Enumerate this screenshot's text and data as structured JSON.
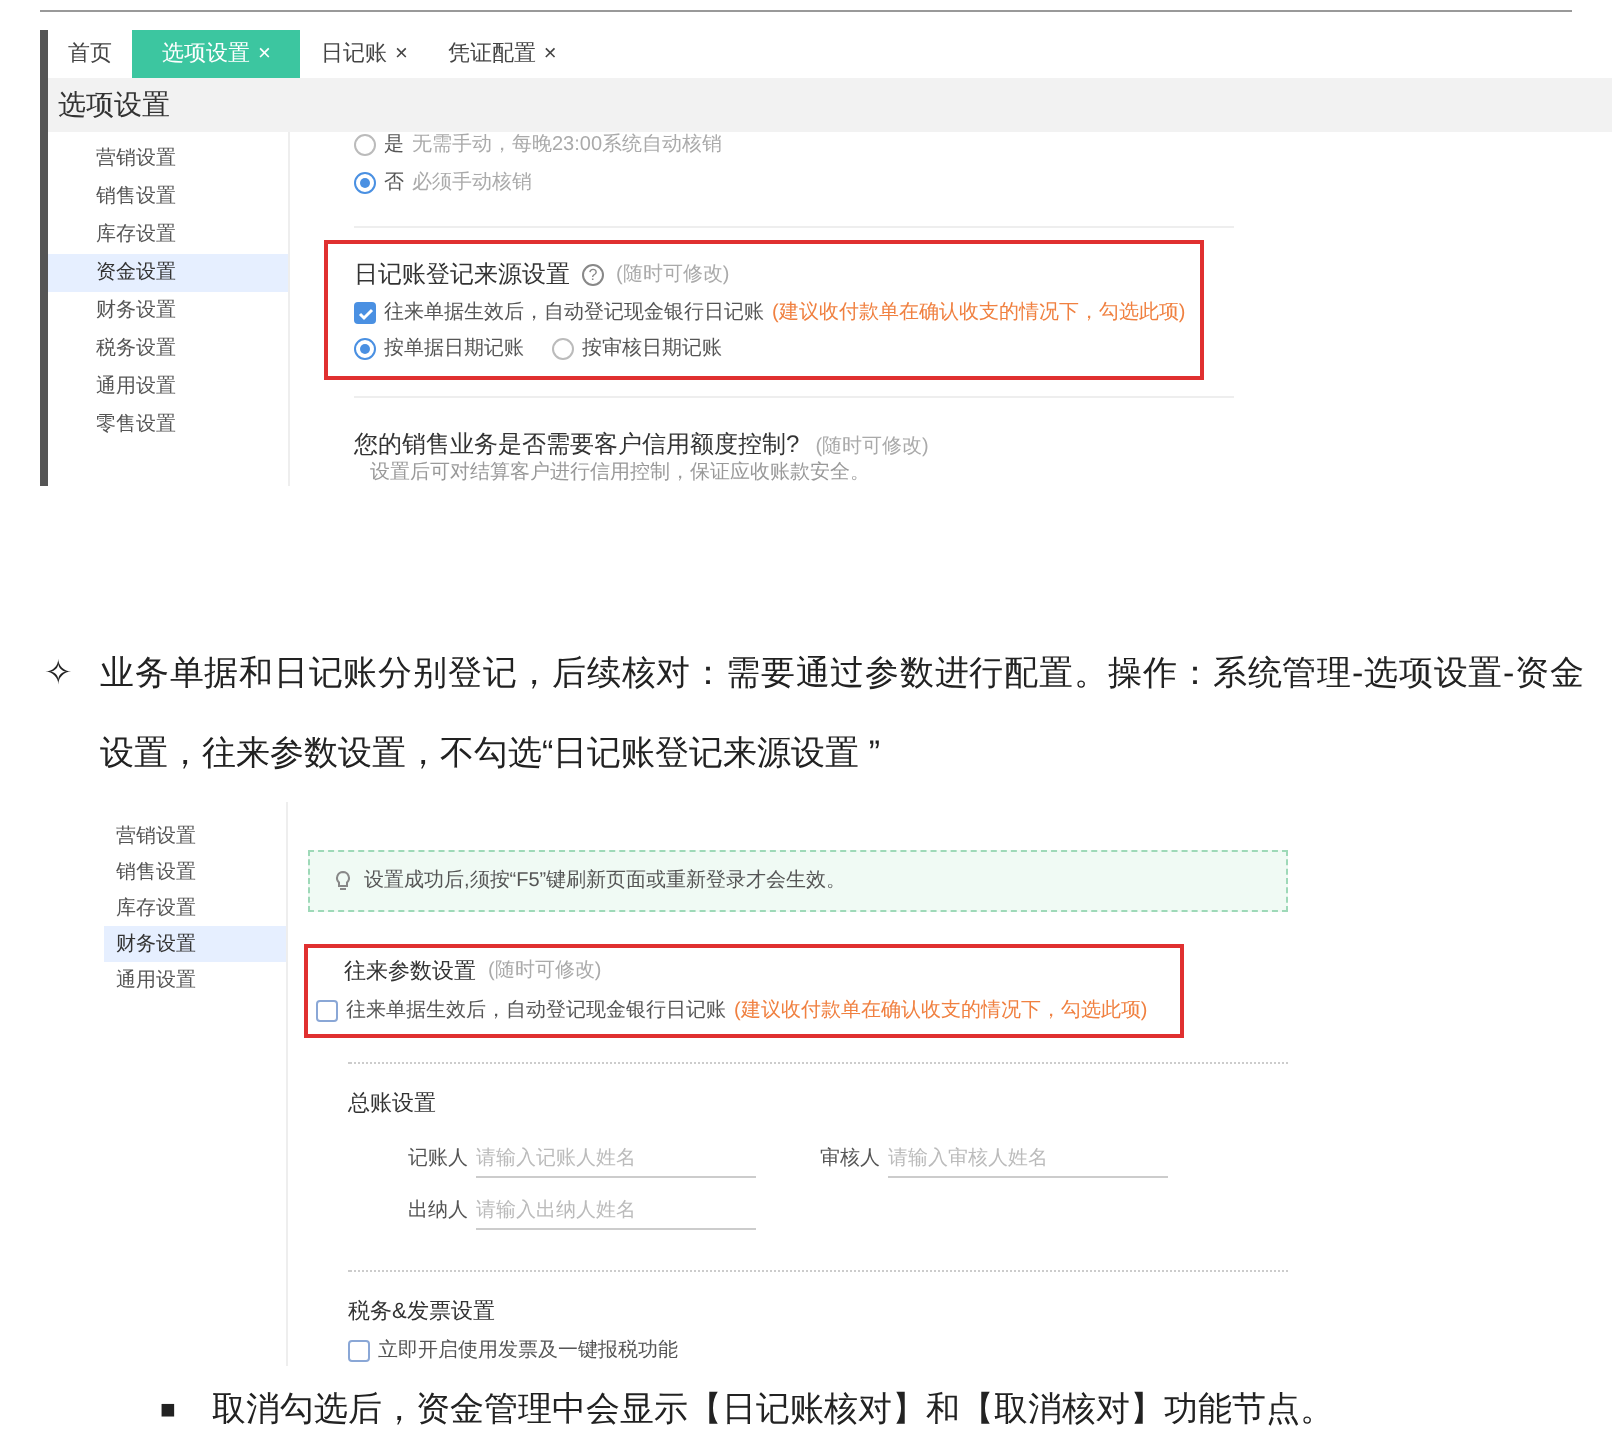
{
  "screenshot_1": {
    "tabs": [
      {
        "label": "首页",
        "selected": false
      },
      {
        "label": "选项设置",
        "close": "×",
        "selected": true
      },
      {
        "label": "日记账",
        "close": "×",
        "selected": false
      },
      {
        "label": "凭证配置",
        "close": "×",
        "selected": false
      }
    ],
    "panel_title": "选项设置",
    "sidebar": [
      {
        "label": "营销设置",
        "selected": false
      },
      {
        "label": "销售设置",
        "selected": false
      },
      {
        "label": "库存设置",
        "selected": false
      },
      {
        "label": "资金设置",
        "selected": true
      },
      {
        "label": "财务设置",
        "selected": false
      },
      {
        "label": "税务设置",
        "selected": false
      },
      {
        "label": "通用设置",
        "selected": false
      },
      {
        "label": "零售设置",
        "selected": false
      }
    ],
    "writeoff_options": [
      {
        "label": "是",
        "hint": "无需手动，每晚23:00系统自动核销",
        "selected": false
      },
      {
        "label": "否",
        "hint": "必须手动核销",
        "selected": true
      }
    ],
    "journal_source": {
      "title": "日记账登记来源设置",
      "help": "?",
      "note": "(随时可修改)",
      "checkbox": {
        "label": "往来单据生效后，自动登记现金银行日记账",
        "advice": "(建议收付款单在确认收支的情况下，勾选此项)",
        "checked": true
      },
      "radios": [
        {
          "label": "按单据日期记账",
          "selected": true
        },
        {
          "label": "按审核日期记账",
          "selected": false
        }
      ]
    },
    "credit_control": {
      "title": "您的销售业务是否需要客户信用额度控制?",
      "note": "(随时可修改)",
      "description": "设置后可对结算客户进行信用控制，保证应收账款安全。"
    }
  },
  "bullet_1": {
    "marker": "✧",
    "text": "业务单据和日记账分别登记，后续核对：需要通过参数进行配置。操作：系统管理-选项设置-资金设置，往来参数设置，不勾选“日记账登记来源设置 ”"
  },
  "screenshot_2": {
    "sidebar": [
      {
        "label": "营销设置",
        "selected": false
      },
      {
        "label": "销售设置",
        "selected": false
      },
      {
        "label": "库存设置",
        "selected": false
      },
      {
        "label": "财务设置",
        "selected": true
      },
      {
        "label": "通用设置",
        "selected": false
      }
    ],
    "notice": "设置成功后,须按“F5”键刷新页面或重新登录才会生效。",
    "ar_params": {
      "title": "往来参数设置",
      "note": "(随时可修改)",
      "checkbox": {
        "label": "往来单据生效后，自动登记现金银行日记账",
        "advice": "(建议收付款单在确认收支的情况下，勾选此项)",
        "checked": false
      }
    },
    "ledger": {
      "title": "总账设置",
      "fields": [
        {
          "label": "记账人",
          "placeholder": "请输入记账人姓名"
        },
        {
          "label": "审核人",
          "placeholder": "请输入审核人姓名"
        },
        {
          "label": "出纳人",
          "placeholder": "请输入出纳人姓名"
        }
      ]
    },
    "tax": {
      "title": "税务&发票设置",
      "checkbox": {
        "label": "立即开启使用发票及一键报税功能",
        "checked": false
      }
    }
  },
  "bullet_2": {
    "marker": "■",
    "text": "取消勾选后，资金管理中会显示【日记账核对】和【取消核对】功能节点。"
  }
}
